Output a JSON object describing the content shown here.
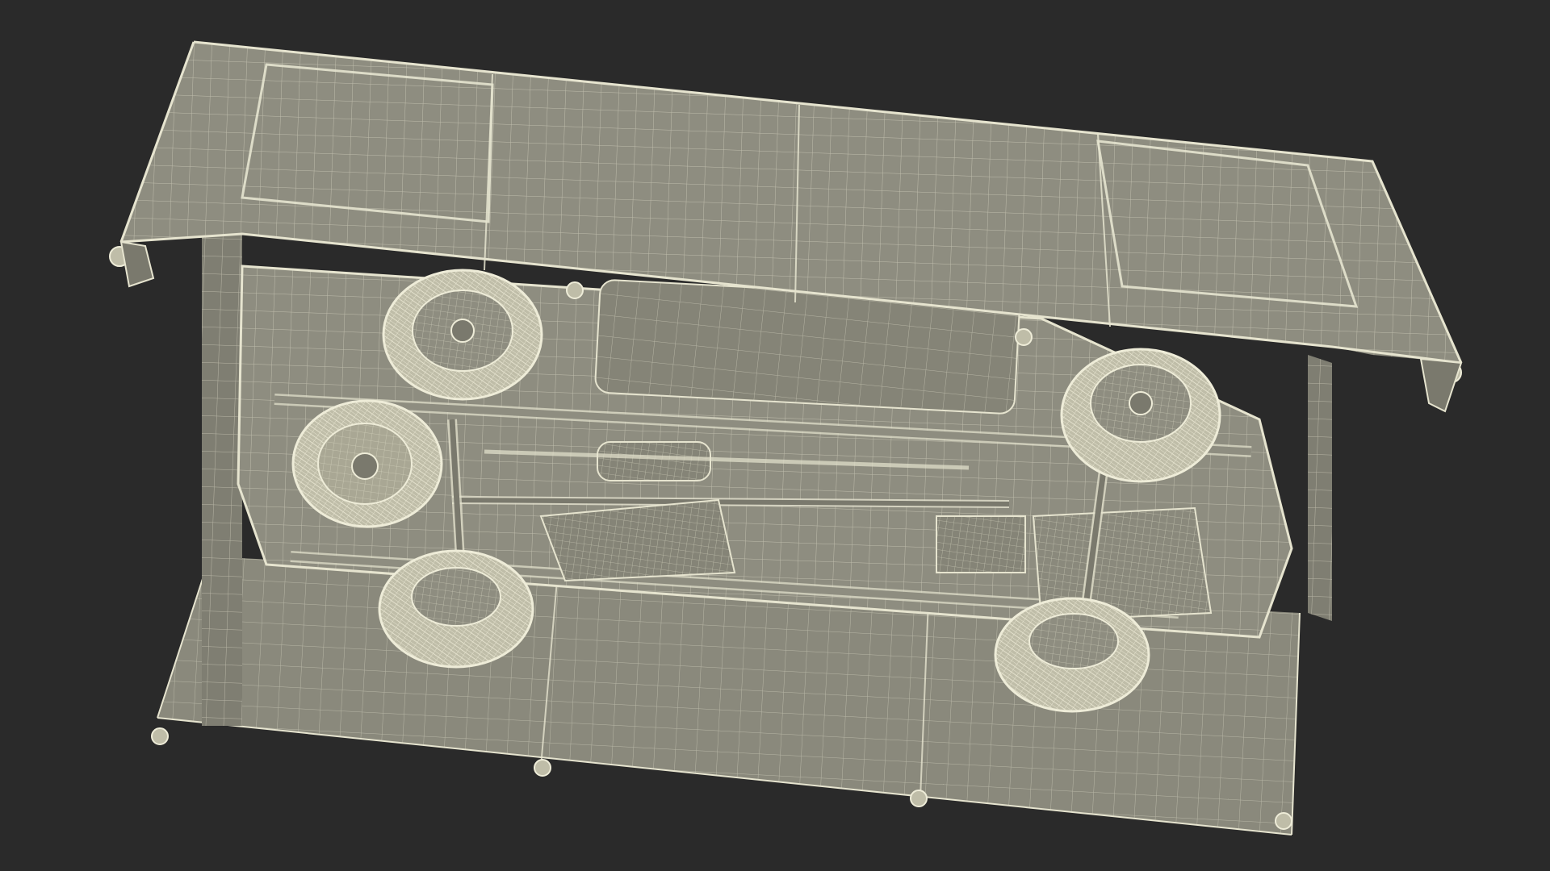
{
  "scene": {
    "background_color": "#2a2a2a",
    "surface_color": "#8e8d80",
    "surface_dark_color": "#7a796d",
    "wire_color": "#e6e4cf",
    "shadow_color": "#5e5d54"
  }
}
